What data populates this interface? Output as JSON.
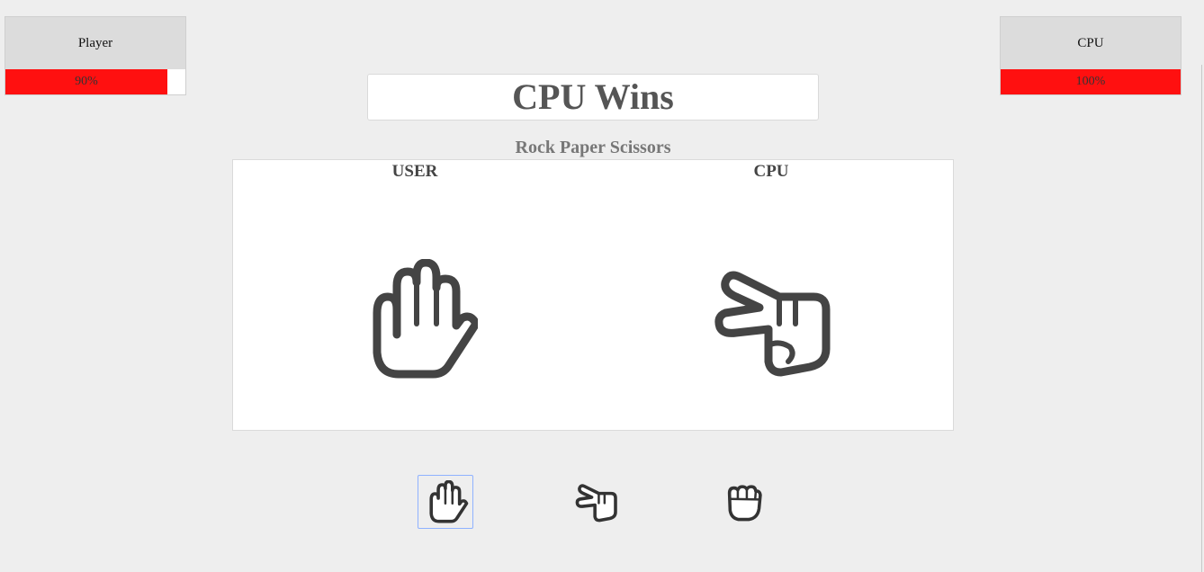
{
  "scoreboard": {
    "player": {
      "name": "Player",
      "percent_label": "90%",
      "health_fraction": 0.9
    },
    "cpu": {
      "name": "CPU",
      "percent_label": "100%",
      "health_fraction": 1.0
    }
  },
  "result": {
    "text": "CPU Wins"
  },
  "game": {
    "title": "Rock Paper Scissors"
  },
  "arena": {
    "user_label": "USER",
    "cpu_label": "CPU",
    "user_choice_icon": "paper-hand-icon",
    "cpu_choice_icon": "scissors-hand-icon"
  },
  "choices": [
    {
      "name": "paper",
      "icon": "paper-hand-icon",
      "selected": true
    },
    {
      "name": "scissors",
      "icon": "scissors-hand-icon",
      "selected": false
    },
    {
      "name": "rock",
      "icon": "rock-fist-icon",
      "selected": false
    }
  ],
  "colors": {
    "health_bar": "#ff1010",
    "icon_stroke": "#444444",
    "selected_outline": "#8fb2ff"
  }
}
